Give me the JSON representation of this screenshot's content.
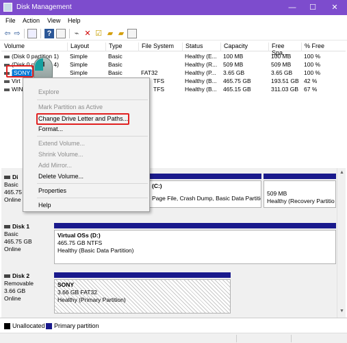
{
  "window": {
    "title": "Disk Management",
    "minimize": "—",
    "maximize": "☐",
    "close": "✕"
  },
  "menu": [
    "File",
    "Action",
    "View",
    "Help"
  ],
  "volume_list": {
    "columns": [
      "Volume",
      "Layout",
      "Type",
      "File System",
      "Status",
      "Capacity",
      "Free Spa...",
      "% Free"
    ],
    "rows": [
      {
        "volume": "(Disk 0 partition 1)",
        "layout": "Simple",
        "type": "Basic",
        "fs": "",
        "status": "Healthy (E...",
        "capacity": "100 MB",
        "free": "100 MB",
        "pct": "100 %"
      },
      {
        "volume": "(Disk 0 partition 4)",
        "layout": "Simple",
        "type": "Basic",
        "fs": "",
        "status": "Healthy (R...",
        "capacity": "509 MB",
        "free": "509 MB",
        "pct": "100 %"
      },
      {
        "volume": "SONY",
        "layout": "Simple",
        "type": "Basic",
        "fs": "FAT32",
        "status": "Healthy (P...",
        "capacity": "3.65 GB",
        "free": "3.65 GB",
        "pct": "100 %"
      },
      {
        "volume": "Virt",
        "layout": "",
        "type": "",
        "fs": "TFS",
        "status": "Healthy (B...",
        "capacity": "465.75 GB",
        "free": "193.51 GB",
        "pct": "42 %"
      },
      {
        "volume": "WIN",
        "layout": "",
        "type": "",
        "fs": "TFS",
        "status": "Healthy (B...",
        "capacity": "465.15 GB",
        "free": "311.03 GB",
        "pct": "67 %"
      }
    ]
  },
  "context_menu": {
    "items": [
      {
        "label": "Explore",
        "enabled": false
      },
      {
        "label": "Mark Partition as Active",
        "enabled": false
      },
      {
        "label": "Change Drive Letter and Paths...",
        "enabled": true
      },
      {
        "label": "Format...",
        "enabled": true
      },
      {
        "label": "Extend Volume...",
        "enabled": false
      },
      {
        "label": "Shrink Volume...",
        "enabled": false
      },
      {
        "label": "Add Mirror...",
        "enabled": false
      },
      {
        "label": "Delete Volume...",
        "enabled": true
      },
      {
        "label": "Properties",
        "enabled": true
      },
      {
        "label": "Help",
        "enabled": true
      }
    ]
  },
  "disks": [
    {
      "name": "Di",
      "kind": "Basic",
      "size": "465.75",
      "state": "Online",
      "partitions": [
        {
          "name": "(C:)",
          "line2": "",
          "line3": "Page File, Crash Dump, Basic Data Partition"
        },
        {
          "name": "",
          "line2": "509 MB",
          "line3": "Healthy (Recovery Partitio"
        }
      ]
    },
    {
      "name": "Disk 1",
      "kind": "Basic",
      "size": "465.75 GB",
      "state": "Online",
      "partitions": [
        {
          "name": "Virtual OSs  (D:)",
          "line2": "465.75 GB NTFS",
          "line3": "Healthy (Basic Data Partition)"
        }
      ]
    },
    {
      "name": "Disk 2",
      "kind": "Removable",
      "size": "3.66 GB",
      "state": "Online",
      "partitions": [
        {
          "name": "SONY",
          "line2": "3.66 GB FAT32",
          "line3": "Healthy (Primary Partition)"
        }
      ]
    }
  ],
  "legend": [
    {
      "label": "Unallocated",
      "color": "#000000"
    },
    {
      "label": "Primary partition",
      "color": "#1a1a8c"
    }
  ],
  "colors": {
    "titlebar": "#7d4ccd",
    "selection": "#0078d7",
    "highlight_box": "#e02020",
    "partition_bar": "#1a1a8c"
  }
}
